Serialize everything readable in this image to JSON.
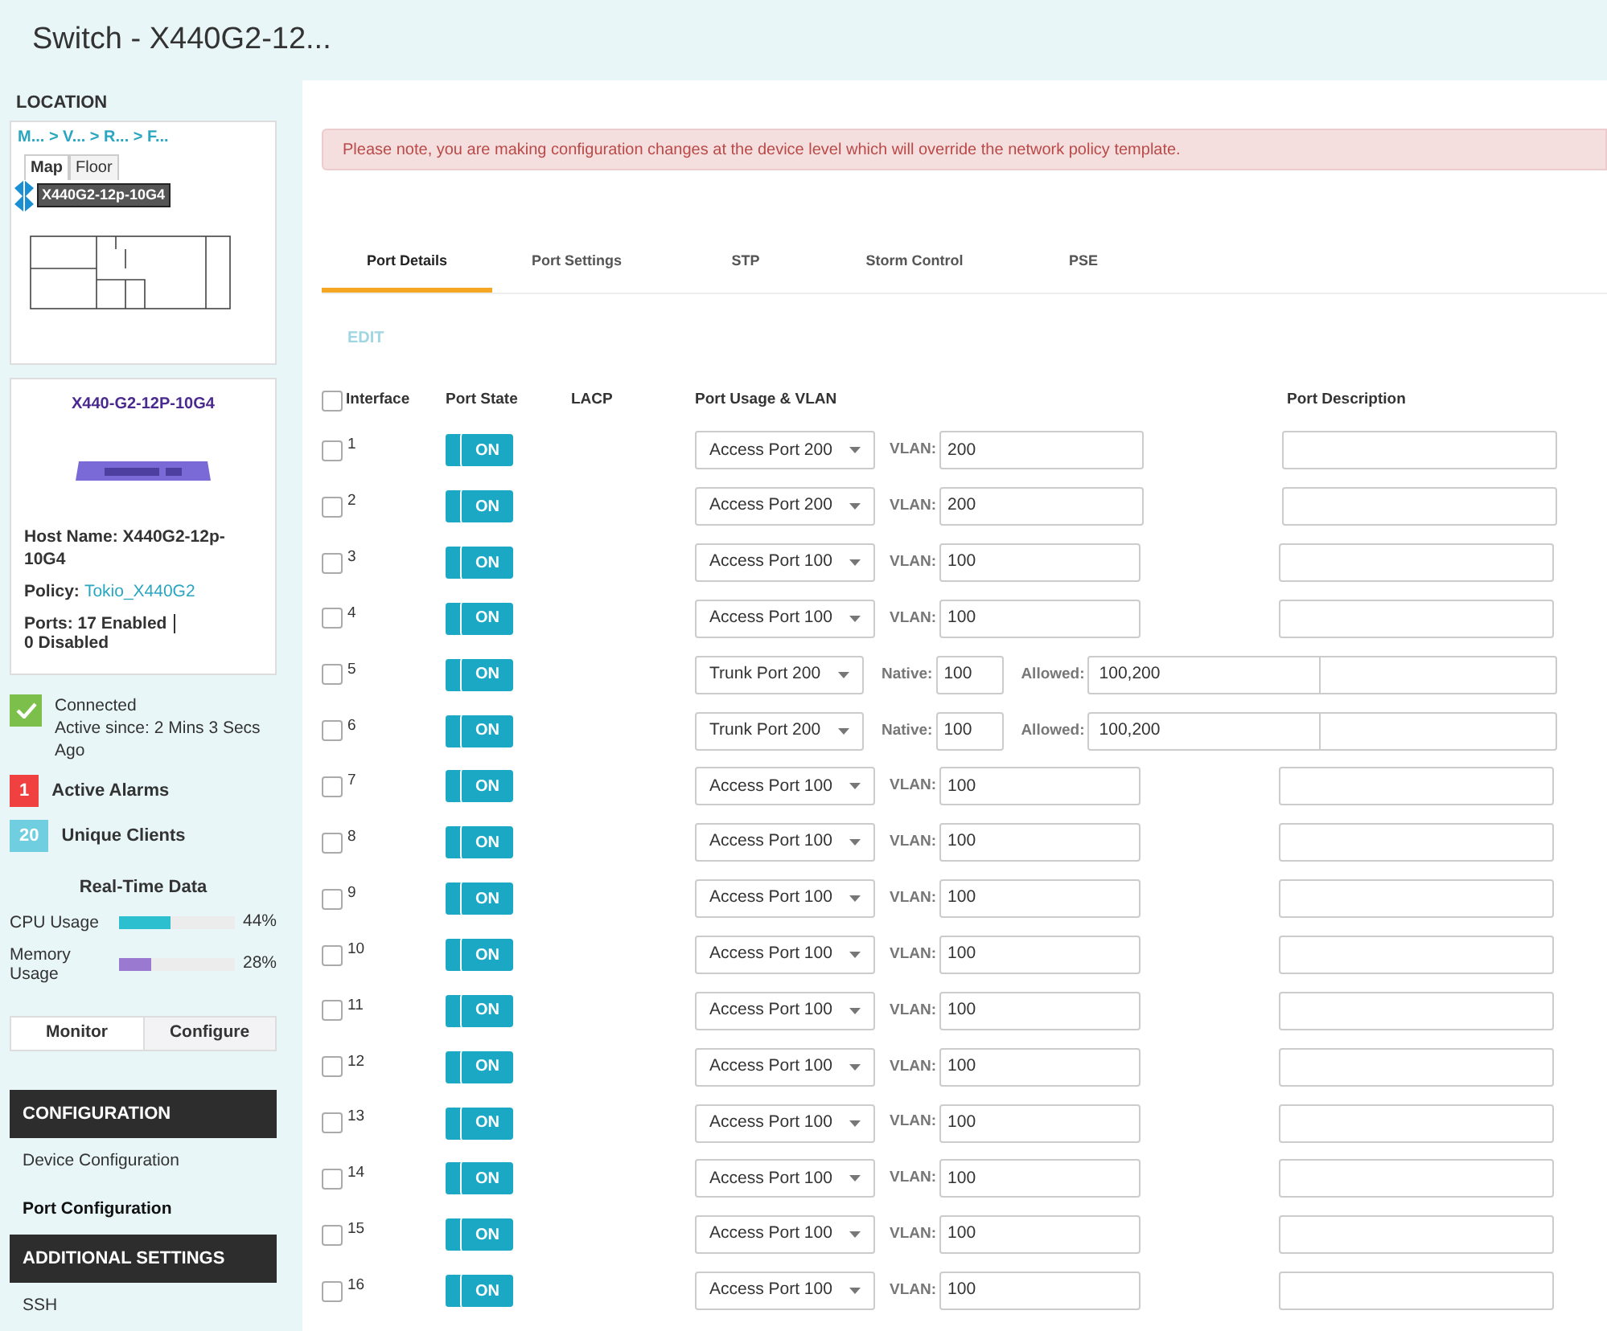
{
  "header": {
    "title": "Switch - X440G2-12..."
  },
  "sidebar": {
    "location": {
      "label": "LOCATION",
      "breadcrumb": "M... > V... > R... > F...",
      "map_tabs": [
        {
          "label": "Map",
          "selected": true
        },
        {
          "label": "Floor",
          "selected": false
        }
      ],
      "device_tag": "X440G2-12p-10G4"
    },
    "device": {
      "model": "X440-G2-12P-10G4",
      "host_name": "Host Name: X440G2-12p-10G4",
      "policy_label": "Policy:",
      "policy": "Tokio_X440G2",
      "ports_enabled": "Ports: 17 Enabled",
      "ports_disabled": "0 Disabled"
    },
    "status": {
      "connection": "Connected",
      "active_since": "Active since: 2 Mins 3 Secs Ago",
      "alarms": [
        {
          "count": "1",
          "label": "Active Alarms",
          "color": "#f04040"
        },
        {
          "count": "20",
          "label": "Unique Clients",
          "color": "#6fcfe0"
        }
      ]
    },
    "realtime": {
      "title": "Real-Time Data",
      "metrics": [
        {
          "label": "CPU Usage",
          "level": 0.44,
          "reading": "44%",
          "color": "#2bbfcf"
        },
        {
          "label": "Memory Usage",
          "level": 0.28,
          "reading": "28%",
          "color": "#9a7ad0"
        }
      ]
    },
    "view_tabs": [
      {
        "label": "Monitor",
        "selected": true
      },
      {
        "label": "Configure",
        "selected": false
      }
    ],
    "nav": [
      {
        "title": "CONFIGURATION",
        "items": [
          {
            "label": "Device Configuration",
            "selected": false
          },
          {
            "label": "Port Configuration",
            "selected": true
          }
        ]
      },
      {
        "title": "ADDITIONAL SETTINGS",
        "items": [
          {
            "label": "SSH",
            "selected": false
          }
        ]
      }
    ]
  },
  "main": {
    "notice": "Please note, you are making configuration changes at the device level which will override the network policy template.",
    "tabs": [
      {
        "label": "Port Details",
        "selected": true
      },
      {
        "label": "Port Settings",
        "selected": false
      },
      {
        "label": "STP",
        "selected": false
      },
      {
        "label": "Storm Control",
        "selected": false
      },
      {
        "label": "PSE",
        "selected": false
      }
    ],
    "edit": {
      "label": "EDIT",
      "disabled": true
    },
    "table": {
      "columns": [
        "Interface",
        "Port State",
        "LACP",
        "Port Usage & VLAN",
        "Port Description"
      ],
      "all_checked": false,
      "rows": [
        {
          "interface": "1",
          "checked": false,
          "on": true,
          "state": "ON",
          "kind": "access",
          "usage": "Access Port 200",
          "vlan_label": "VLAN:",
          "vlan": "200"
        },
        {
          "interface": "2",
          "checked": false,
          "on": true,
          "state": "ON",
          "kind": "access",
          "usage": "Access Port 200",
          "vlan_label": "VLAN:",
          "vlan": "200"
        },
        {
          "interface": "3",
          "checked": false,
          "on": true,
          "state": "ON",
          "kind": "access",
          "usage": "Access Port 100",
          "vlan_label": "VLAN:",
          "vlan": "100"
        },
        {
          "interface": "4",
          "checked": false,
          "on": true,
          "state": "ON",
          "kind": "access",
          "usage": "Access Port 100",
          "vlan_label": "VLAN:",
          "vlan": "100"
        },
        {
          "interface": "5",
          "checked": false,
          "on": true,
          "state": "ON",
          "kind": "trunk",
          "usage": "Trunk Port 200",
          "native_label": "Native:",
          "native": "100",
          "allowed_label": "Allowed:",
          "allowed": "100,200"
        },
        {
          "interface": "6",
          "checked": false,
          "on": true,
          "state": "ON",
          "kind": "trunk",
          "usage": "Trunk Port 200",
          "native_label": "Native:",
          "native": "100",
          "allowed_label": "Allowed:",
          "allowed": "100,200"
        },
        {
          "interface": "7",
          "checked": false,
          "on": true,
          "state": "ON",
          "kind": "access",
          "usage": "Access Port 100",
          "vlan_label": "VLAN:",
          "vlan": "100"
        },
        {
          "interface": "8",
          "checked": false,
          "on": true,
          "state": "ON",
          "kind": "access",
          "usage": "Access Port 100",
          "vlan_label": "VLAN:",
          "vlan": "100"
        },
        {
          "interface": "9",
          "checked": false,
          "on": true,
          "state": "ON",
          "kind": "access",
          "usage": "Access Port 100",
          "vlan_label": "VLAN:",
          "vlan": "100"
        },
        {
          "interface": "10",
          "checked": false,
          "on": true,
          "state": "ON",
          "kind": "access",
          "usage": "Access Port 100",
          "vlan_label": "VLAN:",
          "vlan": "100"
        },
        {
          "interface": "11",
          "checked": false,
          "on": true,
          "state": "ON",
          "kind": "access",
          "usage": "Access Port 100",
          "vlan_label": "VLAN:",
          "vlan": "100"
        },
        {
          "interface": "12",
          "checked": false,
          "on": true,
          "state": "ON",
          "kind": "access",
          "usage": "Access Port 100",
          "vlan_label": "VLAN:",
          "vlan": "100"
        },
        {
          "interface": "13",
          "checked": false,
          "on": true,
          "state": "ON",
          "kind": "access",
          "usage": "Access Port 100",
          "vlan_label": "VLAN:",
          "vlan": "100"
        },
        {
          "interface": "14",
          "checked": false,
          "on": true,
          "state": "ON",
          "kind": "access",
          "usage": "Access Port 100",
          "vlan_label": "VLAN:",
          "vlan": "100"
        },
        {
          "interface": "15",
          "checked": false,
          "on": true,
          "state": "ON",
          "kind": "access",
          "usage": "Access Port 100",
          "vlan_label": "VLAN:",
          "vlan": "100"
        },
        {
          "interface": "16",
          "checked": false,
          "on": true,
          "state": "ON",
          "kind": "access",
          "usage": "Access Port 100",
          "vlan_label": "VLAN:",
          "vlan": "100"
        }
      ]
    }
  }
}
